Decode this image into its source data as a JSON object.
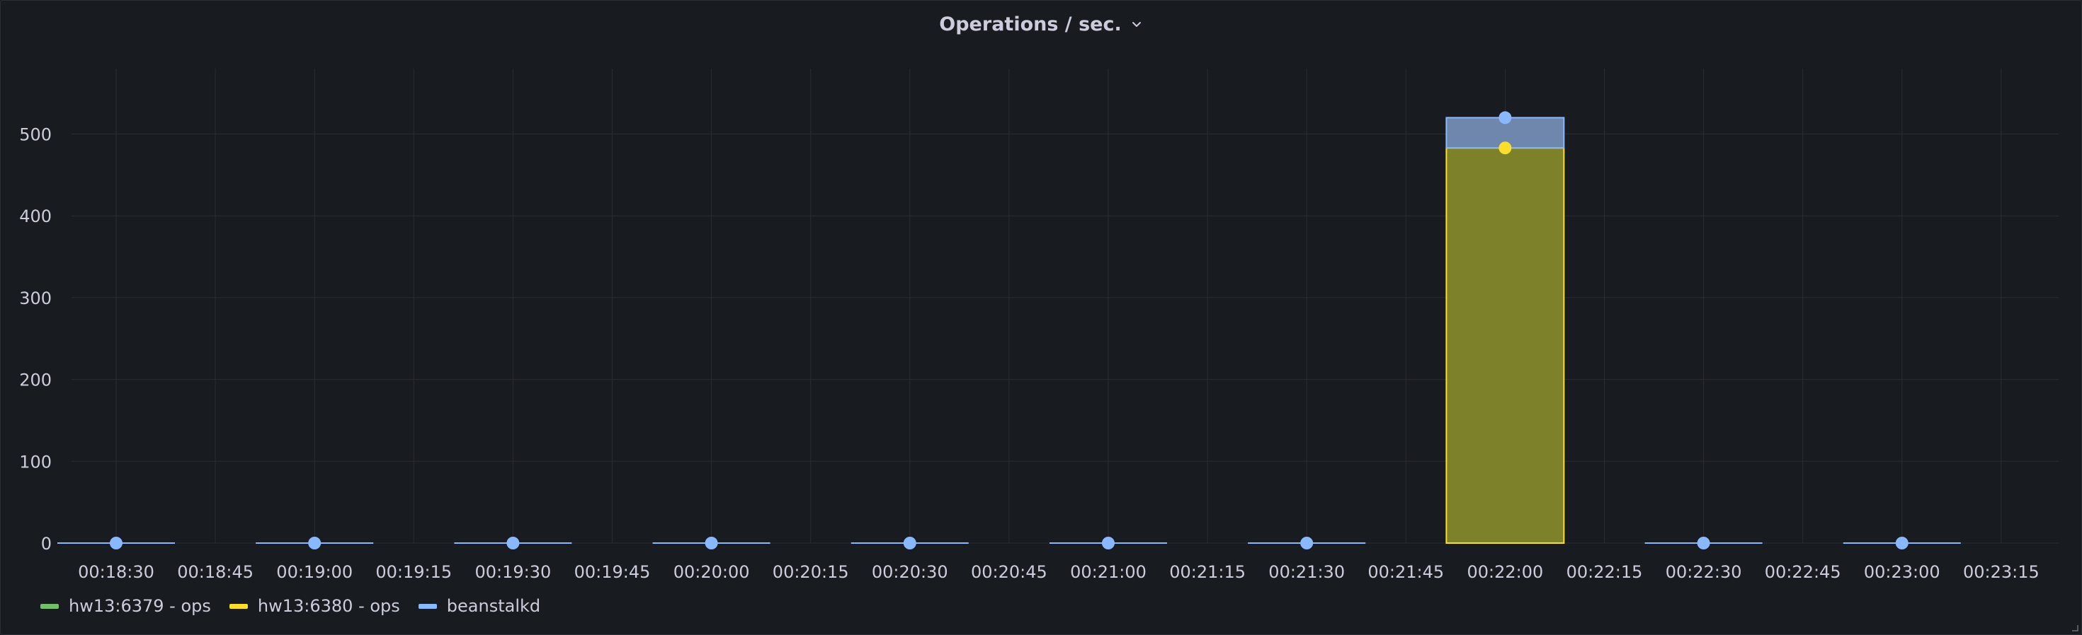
{
  "panel": {
    "title": "Operations / sec."
  },
  "chart_data": {
    "type": "bar",
    "title": "Operations / sec.",
    "xlabel": "",
    "ylabel": "",
    "ylim": [
      0,
      580
    ],
    "y_ticks": [
      0,
      100,
      200,
      300,
      400,
      500
    ],
    "x_tick_labels": [
      "00:18:30",
      "00:18:45",
      "00:19:00",
      "00:19:15",
      "00:19:30",
      "00:19:45",
      "00:20:00",
      "00:20:15",
      "00:20:30",
      "00:20:45",
      "00:21:00",
      "00:21:15",
      "00:21:30",
      "00:21:45",
      "00:22:00",
      "00:22:15",
      "00:22:30",
      "00:22:45",
      "00:23:00",
      "00:23:15"
    ],
    "categories": [
      "00:18:30",
      "00:19:00",
      "00:19:30",
      "00:20:00",
      "00:20:30",
      "00:21:00",
      "00:21:30",
      "00:22:00",
      "00:22:30",
      "00:23:00"
    ],
    "stacked": true,
    "grid": true,
    "legend_position": "bottom-left",
    "series": [
      {
        "name": "hw13:6379 - ops",
        "color": "#73bf69",
        "values": [
          0,
          0,
          0,
          0,
          0,
          0,
          0,
          0,
          0,
          0
        ]
      },
      {
        "name": "hw13:6380 - ops",
        "color": "#fade2a",
        "values": [
          0,
          0,
          0,
          0,
          0,
          0,
          0,
          483,
          0,
          0
        ]
      },
      {
        "name": "beanstalkd",
        "color": "#8ab8ff",
        "values": [
          0,
          0,
          0,
          0,
          0,
          0,
          0,
          37,
          0,
          0
        ]
      }
    ]
  }
}
